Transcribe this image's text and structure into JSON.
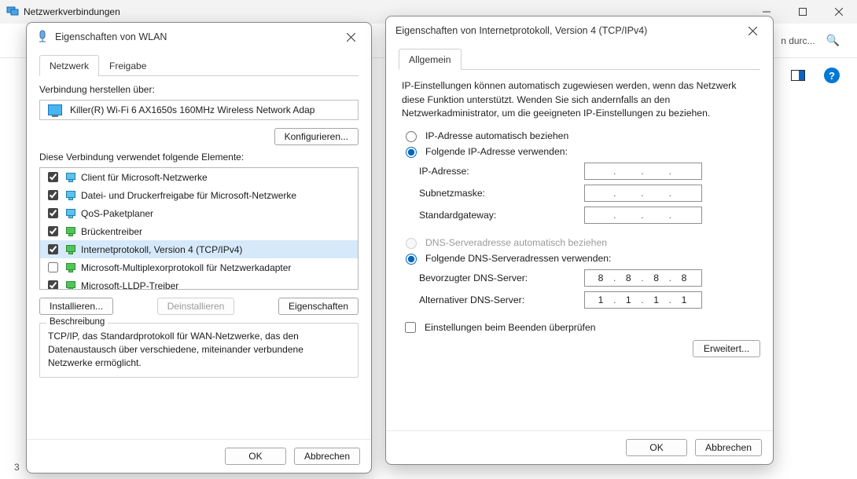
{
  "main_window": {
    "title": "Netzwerkverbindungen",
    "search_truncated": "n durc...",
    "status_left": "3"
  },
  "wlan_dialog": {
    "title": "Eigenschaften von WLAN",
    "tabs": {
      "network": "Netzwerk",
      "sharing": "Freigabe"
    },
    "connect_using": "Verbindung herstellen über:",
    "adapter_name": "Killer(R) Wi-Fi 6 AX1650s 160MHz Wireless Network Adap",
    "configure_btn": "Konfigurieren...",
    "uses_items_label": "Diese Verbindung verwendet folgende Elemente:",
    "items": [
      {
        "label": "Client für Microsoft-Netzwerke",
        "checked": true,
        "icon": "blue"
      },
      {
        "label": "Datei- und Druckerfreigabe für Microsoft-Netzwerke",
        "checked": true,
        "icon": "blue"
      },
      {
        "label": "QoS-Paketplaner",
        "checked": true,
        "icon": "blue"
      },
      {
        "label": "Brückentreiber",
        "checked": true,
        "icon": "green"
      },
      {
        "label": "Internetprotokoll, Version 4 (TCP/IPv4)",
        "checked": true,
        "icon": "green",
        "selected": true
      },
      {
        "label": "Microsoft-Multiplexorprotokoll für Netzwerkadapter",
        "checked": false,
        "icon": "green"
      },
      {
        "label": "Microsoft-LLDP-Treiber",
        "checked": true,
        "icon": "green"
      }
    ],
    "install_btn": "Installieren...",
    "uninstall_btn": "Deinstallieren",
    "properties_btn": "Eigenschaften",
    "desc_title": "Beschreibung",
    "desc_text": "TCP/IP, das Standardprotokoll für WAN-Netzwerke, das den Datenaustausch über verschiedene, miteinander verbundene Netzwerke ermöglicht.",
    "ok": "OK",
    "cancel": "Abbrechen"
  },
  "ipv4_dialog": {
    "title": "Eigenschaften von Internetprotokoll, Version 4 (TCP/IPv4)",
    "tab_general": "Allgemein",
    "intro": "IP-Einstellungen können automatisch zugewiesen werden, wenn das Netzwerk diese Funktion unterstützt. Wenden Sie sich andernfalls an den Netzwerkadministrator, um die geeigneten IP-Einstellungen zu beziehen.",
    "ip_auto": "IP-Adresse automatisch beziehen",
    "ip_manual": "Folgende IP-Adresse verwenden:",
    "ip_addr_label": "IP-Adresse:",
    "subnet_label": "Subnetzmaske:",
    "gateway_label": "Standardgateway:",
    "dns_auto": "DNS-Serveradresse automatisch beziehen",
    "dns_manual": "Folgende DNS-Serveradressen verwenden:",
    "dns_pref_label": "Bevorzugter DNS-Server:",
    "dns_alt_label": "Alternativer DNS-Server:",
    "dns_pref_value": [
      "8",
      "8",
      "8",
      "8"
    ],
    "dns_alt_value": [
      "1",
      "1",
      "1",
      "1"
    ],
    "ip_value": [
      "",
      "",
      "",
      ""
    ],
    "subnet_value": [
      "",
      "",
      "",
      ""
    ],
    "gateway_value": [
      "",
      "",
      "",
      ""
    ],
    "validate": "Einstellungen beim Beenden überprüfen",
    "advanced": "Erweitert...",
    "ok": "OK",
    "cancel": "Abbrechen"
  }
}
